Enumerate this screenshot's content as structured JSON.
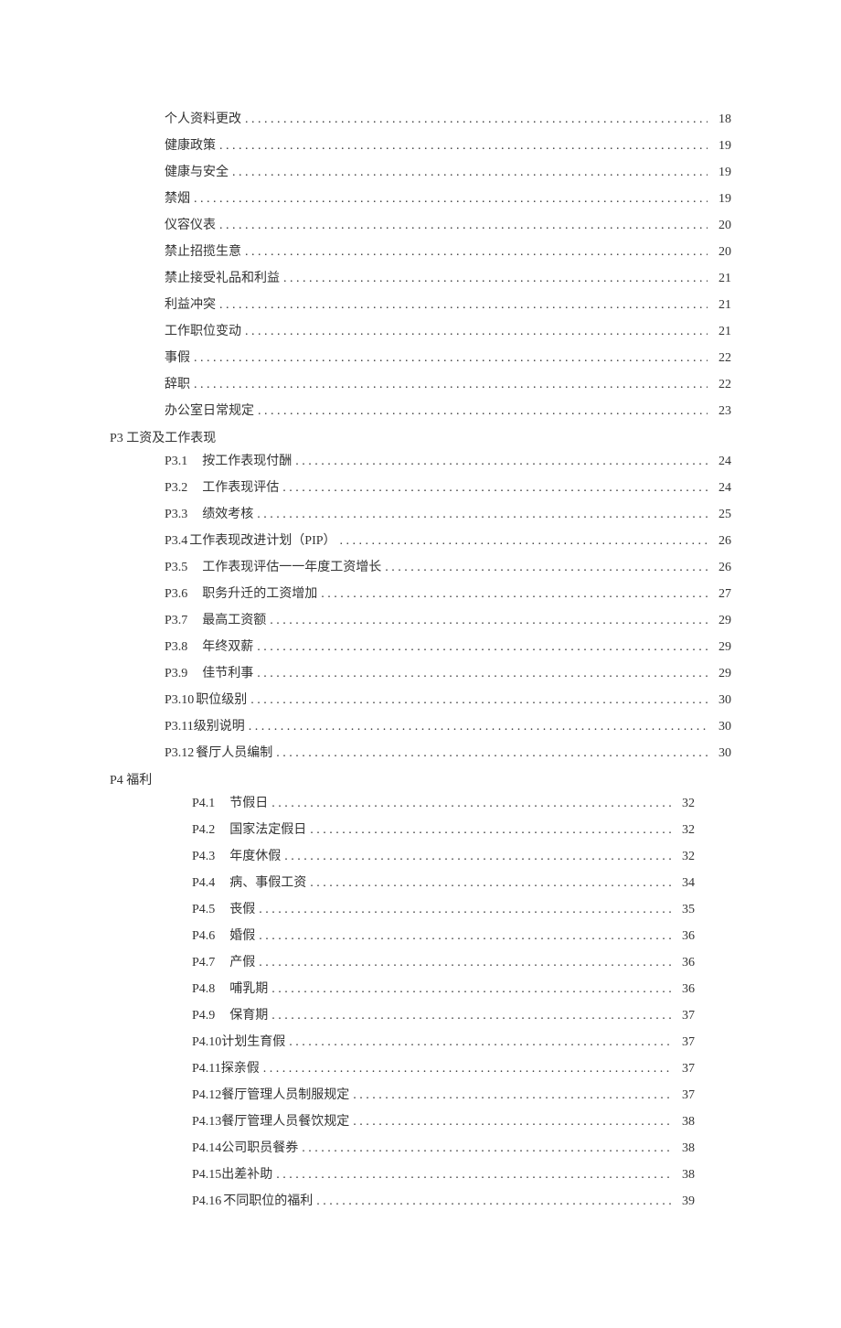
{
  "blocks": [
    {
      "type": "entries",
      "indentClass": "group",
      "entries": [
        {
          "prefix": "",
          "title": "个人资料更改",
          "page": "18"
        },
        {
          "prefix": "",
          "title": "健康政策",
          "page": "19"
        },
        {
          "prefix": "",
          "title": "健康与安全",
          "page": "19"
        },
        {
          "prefix": "",
          "title": "禁烟",
          "page": "19"
        },
        {
          "prefix": "",
          "title": "仪容仪表",
          "page": "20"
        },
        {
          "prefix": "",
          "title": "禁止招揽生意",
          "page": "20"
        },
        {
          "prefix": "",
          "title": "禁止接受礼品和利益",
          "page": "21"
        },
        {
          "prefix": "",
          "title": "利益冲突",
          "page": "21"
        },
        {
          "prefix": "",
          "title": "工作职位变动",
          "page": "21"
        },
        {
          "prefix": "",
          "title": "事假",
          "page": "22"
        },
        {
          "prefix": "",
          "title": "辞职",
          "page": "22"
        },
        {
          "prefix": "",
          "title": "办公室日常规定",
          "page": "23"
        }
      ]
    },
    {
      "type": "header",
      "text": "P3 工资及工作表现"
    },
    {
      "type": "entries",
      "indentClass": "group",
      "entries": [
        {
          "prefix": "P3.1",
          "title": "按工作表现付酬",
          "page": "24",
          "gap": 16
        },
        {
          "prefix": "P3.2",
          "title": "工作表现评估",
          "page": "24",
          "gap": 16
        },
        {
          "prefix": "P3.3",
          "title": "绩效考核",
          "page": "25",
          "gap": 16
        },
        {
          "prefix": " P3.4",
          "title": "工作表现改进计划（PIP）",
          "page": "26",
          "gap": 2
        },
        {
          "prefix": "P3.5",
          "title": "工作表现评估一一年度工资增长",
          "page": "26",
          "gap": 16
        },
        {
          "prefix": "P3.6",
          "title": "职务升迁的工资增加",
          "page": "27",
          "gap": 16
        },
        {
          "prefix": "P3.7",
          "title": "最高工资额",
          "page": "29",
          "gap": 16
        },
        {
          "prefix": "P3.8",
          "title": "年终双薪",
          "page": "29",
          "gap": 16
        },
        {
          "prefix": "P3.9",
          "title": "佳节利事",
          "page": "29",
          "gap": 16
        },
        {
          "prefix": "P3.10",
          "title": "职位级别",
          "page": "30",
          "gap": 2
        },
        {
          "prefix": "P3.11",
          "title": "级别说明",
          "page": "30",
          "gap": 0
        },
        {
          "prefix": "P3.12",
          "title": "餐厅人员编制",
          "page": "30",
          "gap": 2
        }
      ]
    },
    {
      "type": "header",
      "text": "P4 福利"
    },
    {
      "type": "entries",
      "indentClass": "group-b",
      "entries": [
        {
          "prefix": "P4.1",
          "title": "节假日",
          "page": "32",
          "gap": 16
        },
        {
          "prefix": "P4.2",
          "title": "国家法定假日",
          "page": "32",
          "gap": 16
        },
        {
          "prefix": "P4.3",
          "title": "年度休假",
          "page": "32",
          "gap": 16
        },
        {
          "prefix": "P4.4",
          "title": "病、事假工资",
          "page": "34",
          "gap": 16
        },
        {
          "prefix": "P4.5",
          "title": "丧假",
          "page": "35",
          "gap": 16
        },
        {
          "prefix": "P4.6",
          "title": "婚假",
          "page": "36",
          "gap": 16
        },
        {
          "prefix": "P4.7",
          "title": "产假",
          "page": "36",
          "gap": 16
        },
        {
          "prefix": "P4.8",
          "title": "哺乳期",
          "page": "36",
          "gap": 16
        },
        {
          "prefix": "P4.9",
          "title": "保育期",
          "page": "37",
          "gap": 16
        },
        {
          "prefix": "P4.10",
          "title": "计划生育假",
          "page": "37",
          "gap": 0
        },
        {
          "prefix": "P4.11",
          "title": "探亲假",
          "page": "37",
          "gap": 0
        },
        {
          "prefix": "P4.12",
          "title": "餐厅管理人员制服规定",
          "page": "37",
          "gap": 0
        },
        {
          "prefix": "P4.13",
          "title": "餐厅管理人员餐饮规定",
          "page": "38",
          "gap": 0
        },
        {
          "prefix": "P4.14",
          "title": "公司职员餐券",
          "page": "38",
          "gap": 0
        },
        {
          "prefix": "P4.15",
          "title": "出差补助",
          "page": "38",
          "gap": 0
        },
        {
          "prefix": "P4.16",
          "title": " 不同职位的福利",
          "page": "39",
          "gap": 2
        }
      ]
    }
  ]
}
